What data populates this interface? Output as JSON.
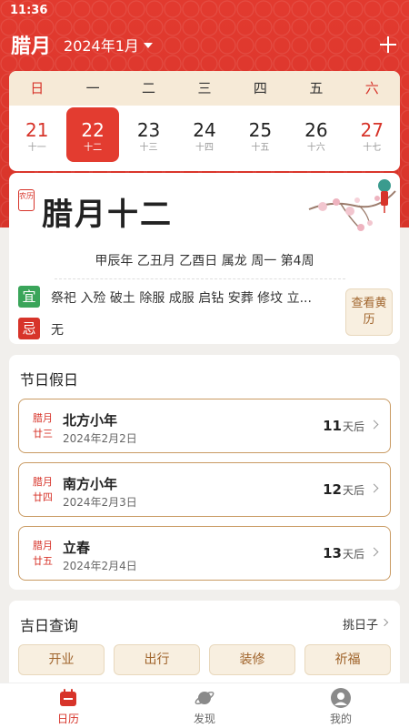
{
  "status": {
    "time": "11:36"
  },
  "header": {
    "lunar_month": "腊月",
    "month_selector": "2024年1月"
  },
  "calendar": {
    "weekdays": [
      "日",
      "一",
      "二",
      "三",
      "四",
      "五",
      "六"
    ],
    "days": [
      {
        "num": "21",
        "lunar": "十一"
      },
      {
        "num": "22",
        "lunar": "十二"
      },
      {
        "num": "23",
        "lunar": "十三"
      },
      {
        "num": "24",
        "lunar": "十四"
      },
      {
        "num": "25",
        "lunar": "十五"
      },
      {
        "num": "26",
        "lunar": "十六"
      },
      {
        "num": "27",
        "lunar": "十七"
      }
    ]
  },
  "detail": {
    "seal": "农历",
    "lunar_date": "腊月十二",
    "ganzhi": "甲辰年 乙丑月 乙酉日 属龙 周一 第4周",
    "yi_label": "宜",
    "yi_text": "祭祀 入殓 破土 除服 成服 启钻 安葬 修坟 立...",
    "ji_label": "忌",
    "ji_text": "无",
    "almanac_button": "查看黄历"
  },
  "holidays": {
    "title": "节日假日",
    "items": [
      {
        "lunar_month": "腊月",
        "lunar_day": "廿三",
        "name": "北方小年",
        "date": "2024年2月2日",
        "days": "11",
        "suffix": "天后"
      },
      {
        "lunar_month": "腊月",
        "lunar_day": "廿四",
        "name": "南方小年",
        "date": "2024年2月3日",
        "days": "12",
        "suffix": "天后"
      },
      {
        "lunar_month": "腊月",
        "lunar_day": "廿五",
        "name": "立春",
        "date": "2024年2月4日",
        "days": "13",
        "suffix": "天后"
      }
    ]
  },
  "good_days": {
    "title": "吉日查询",
    "pick": "挑日子",
    "buttons": [
      "开业",
      "出行",
      "装修",
      "祈福"
    ]
  },
  "tabs": [
    {
      "label": "日历",
      "icon": "calendar-icon"
    },
    {
      "label": "发现",
      "icon": "planet-icon"
    },
    {
      "label": "我的",
      "icon": "user-icon"
    }
  ],
  "colors": {
    "primary": "#d7342a",
    "accent_bg": "#f8efe0",
    "accent_text": "#a0642c",
    "yi": "#3aa55a"
  }
}
